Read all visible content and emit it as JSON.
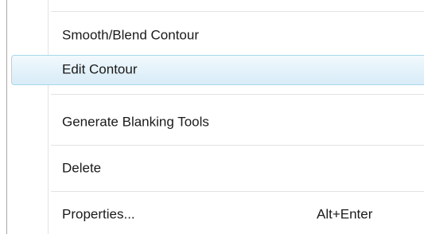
{
  "menu": {
    "items": [
      {
        "label": "Smooth/Blend Contour",
        "shortcut": "",
        "highlighted": false
      },
      {
        "label": "Edit Contour",
        "shortcut": "",
        "highlighted": true
      },
      {
        "label": "Generate Blanking Tools",
        "shortcut": "",
        "highlighted": false
      },
      {
        "label": "Delete",
        "shortcut": "",
        "highlighted": false
      },
      {
        "label": "Properties...",
        "shortcut": "Alt+Enter",
        "highlighted": false
      }
    ]
  },
  "colors": {
    "menu_background": "#ffffff",
    "highlight_border": "#a8d8eb",
    "highlight_fill": "#e4f2fa",
    "separator": "#e2e3e3",
    "text": "#1a1a1a"
  }
}
